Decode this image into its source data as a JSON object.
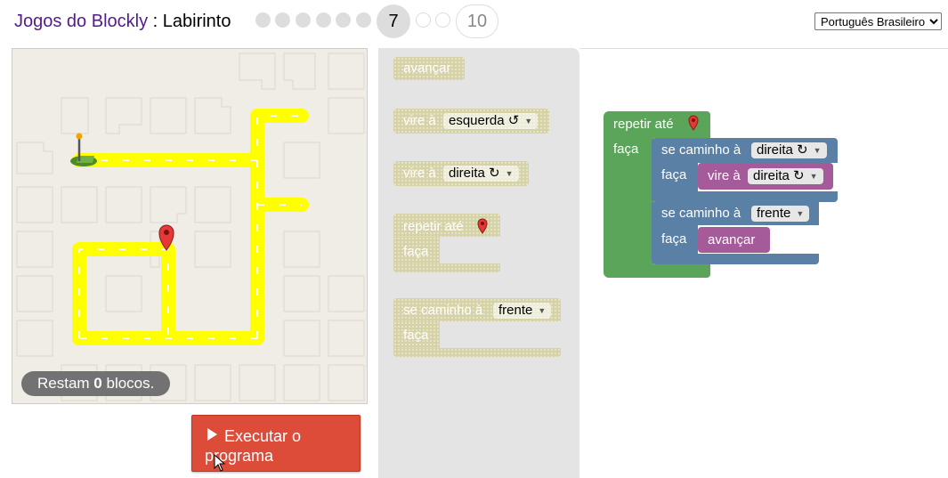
{
  "header": {
    "app_name": "Jogos do Blockly",
    "separator": " : ",
    "game_name": "Labirinto",
    "current_level": "7",
    "last_level": "10",
    "language": "Português Brasileiro"
  },
  "maze": {
    "capacity_prefix": "Restam ",
    "capacity_count": "0",
    "capacity_suffix": " blocos."
  },
  "run_button": {
    "label": "Executar o programa"
  },
  "toolbox": {
    "move_forward": "avançar",
    "turn_prefix": "vire à",
    "turn_left": "esquerda ↺",
    "turn_right": "direita ↻",
    "repeat_until": "repetir até",
    "do": "faça",
    "if_path": "se caminho à",
    "front": "frente"
  },
  "workspace": {
    "repeat_until": "repetir até",
    "do": "faça",
    "if1_label": "se caminho à",
    "if1_dir": "direita ↻",
    "if1_do": "faça",
    "turn_prefix": "vire à",
    "turn_dir": "direita ↻",
    "if2_label": "se caminho à",
    "if2_dir": "frente",
    "if2_do": "faça",
    "move_forward": "avançar"
  },
  "colors": {
    "logic_blue": "#5b80a5",
    "loop_green": "#5ba55b",
    "motion_purple": "#a55b99",
    "run_red": "#dd4b39",
    "path_yellow": "#ffff00",
    "capacity_gray": "#727272"
  }
}
